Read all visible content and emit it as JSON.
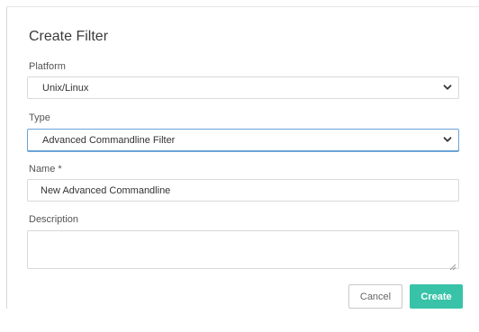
{
  "dialog": {
    "title": "Create Filter"
  },
  "form": {
    "platform": {
      "label": "Platform",
      "value": "Unix/Linux"
    },
    "type": {
      "label": "Type",
      "value": "Advanced Commandline Filter"
    },
    "name": {
      "label": "Name *",
      "value": "New Advanced Commandline"
    },
    "description": {
      "label": "Description",
      "value": ""
    }
  },
  "buttons": {
    "cancel": "Cancel",
    "create": "Create"
  },
  "colors": {
    "primary": "#38c3a8",
    "focus": "#6aa3d8",
    "border": "#d9d9d9"
  },
  "icons": {
    "dropdown": "chevron-down-icon",
    "resize": "resize-grip-icon"
  }
}
